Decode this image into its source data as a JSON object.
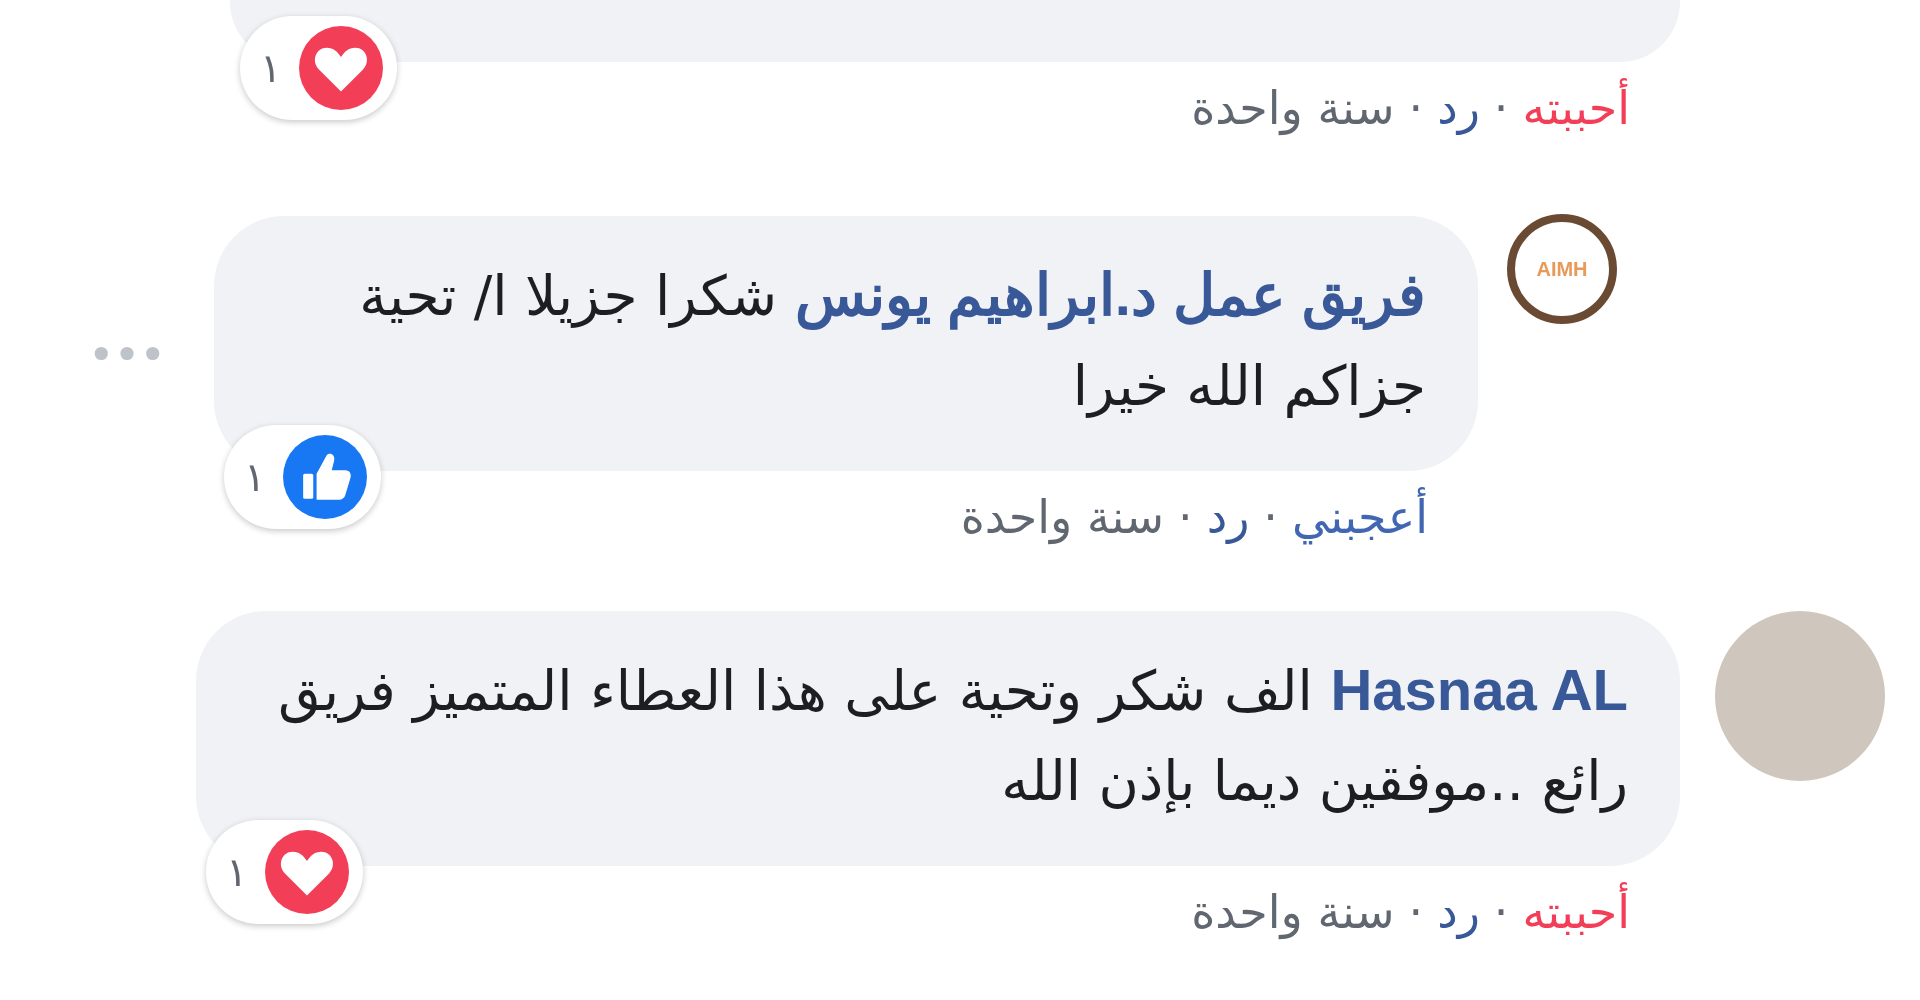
{
  "comments": [
    {
      "kind": "top",
      "reaction": {
        "kind": "love",
        "count": "١"
      },
      "actions": [
        {
          "kind": "loved",
          "text": "أحببته"
        },
        {
          "kind": "sep",
          "text": "·"
        },
        {
          "kind": "reply",
          "text": "رد"
        },
        {
          "kind": "sep",
          "text": "·"
        },
        {
          "kind": "time",
          "text": "سنة واحدة"
        }
      ]
    },
    {
      "kind": "reply",
      "avatar": {
        "kind": "logo",
        "text": "AIMH"
      },
      "author": "فريق عمل د.ابراهيم يونس",
      "text": "شكرا جزيلا ا/ تحية جزاكم الله خيرا",
      "more_menu": true,
      "reaction": {
        "kind": "like",
        "count": "١"
      },
      "actions": [
        {
          "kind": "liked",
          "text": "أعجبني"
        },
        {
          "kind": "sep",
          "text": "·"
        },
        {
          "kind": "reply",
          "text": "رد"
        },
        {
          "kind": "sep",
          "text": "·"
        },
        {
          "kind": "time",
          "text": "سنة واحدة"
        }
      ]
    },
    {
      "kind": "top",
      "avatar": {
        "kind": "photo"
      },
      "author": "Hasnaa AL",
      "text": "الف شكر وتحية على هذا العطاء المتميز فريق رائع ..موفقين ديما بإذن الله",
      "reaction": {
        "kind": "love",
        "count": "١"
      },
      "actions": [
        {
          "kind": "loved",
          "text": "أحببته"
        },
        {
          "kind": "sep",
          "text": "·"
        },
        {
          "kind": "reply",
          "text": "رد"
        },
        {
          "kind": "sep",
          "text": "·"
        },
        {
          "kind": "time",
          "text": "سنة واحدة"
        }
      ]
    }
  ]
}
